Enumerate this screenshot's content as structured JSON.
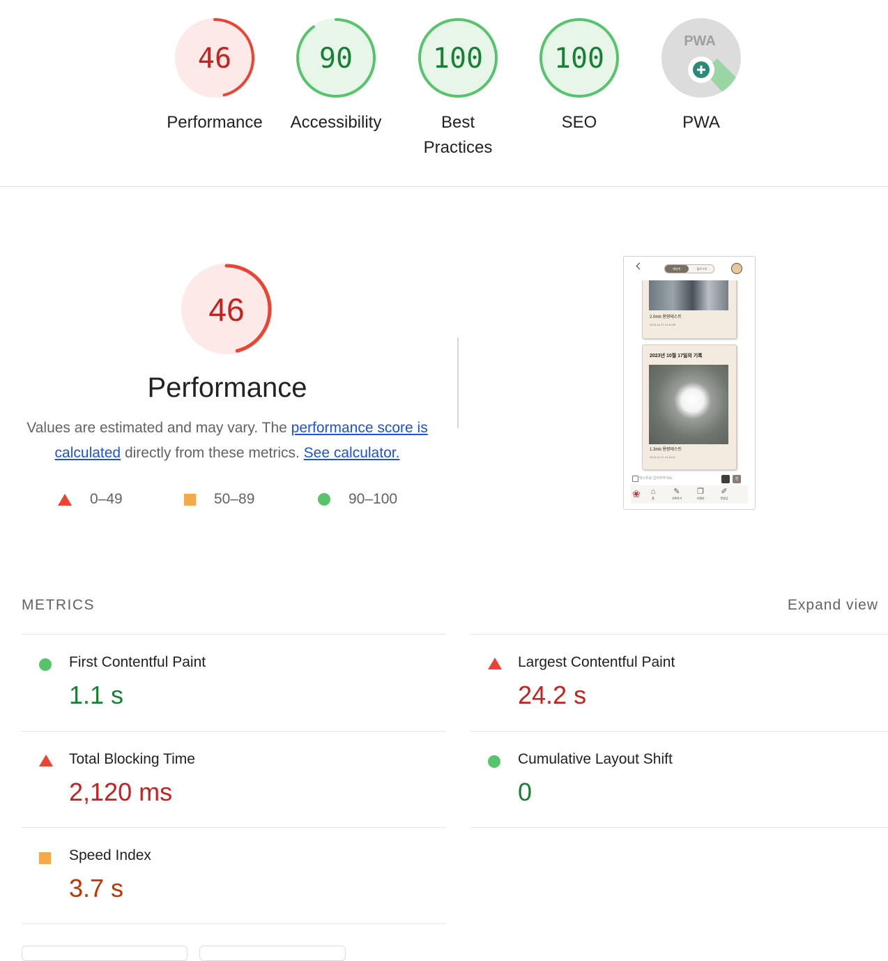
{
  "gauges": [
    {
      "id": "performance",
      "score": "46",
      "label": "Performance",
      "status": "fail",
      "fraction": 0.46
    },
    {
      "id": "accessibility",
      "score": "90",
      "label": "Accessibility",
      "status": "pass",
      "fraction": 0.9
    },
    {
      "id": "best-practices",
      "score": "100",
      "label": "Best Practices",
      "status": "pass",
      "fraction": 1.0
    },
    {
      "id": "seo",
      "score": "100",
      "label": "SEO",
      "status": "pass",
      "fraction": 1.0
    },
    {
      "id": "pwa",
      "score": "",
      "label": "PWA",
      "badge_text": "PWA",
      "status": "na",
      "icon": "pwa-plus-icon"
    }
  ],
  "performance": {
    "score": "46",
    "fraction": 0.46,
    "title": "Performance",
    "desc_prefix": "Values are estimated and may vary. The ",
    "link_score": "performance score is calculated",
    "desc_middle": " directly from these metrics. ",
    "link_calc": "See calculator.",
    "legend": [
      {
        "shape": "triangle",
        "label": "0–49",
        "color": "#eb4334"
      },
      {
        "shape": "square",
        "label": "50–89",
        "color": "#f5a94b"
      },
      {
        "shape": "circle",
        "label": "90–100",
        "color": "#56c46b"
      }
    ]
  },
  "screenshot": {
    "toggle_on": "메일쉬",
    "toggle_off": "블로그쉬",
    "cards": [
      {
        "caption": "2.0mb 용량테스트",
        "timestamp": "2023-10-17 14:14:59"
      },
      {
        "header": "2023년 10월 17일의 기록",
        "caption": "1.3mb 용량테스트",
        "timestamp": "2023-10-17 14:15:11"
      }
    ],
    "input_placeholder": "텍스트를 입력하주세요.",
    "send_label": "전",
    "nav": [
      "홈",
      "기록하기",
      "리캡하",
      "문방답"
    ]
  },
  "metrics": {
    "heading": "METRICS",
    "expand_label": "Expand view",
    "items": [
      {
        "name": "First Contentful Paint",
        "value": "1.1 s",
        "status": "pass"
      },
      {
        "name": "Largest Contentful Paint",
        "value": "24.2 s",
        "status": "fail"
      },
      {
        "name": "Total Blocking Time",
        "value": "2,120 ms",
        "status": "fail"
      },
      {
        "name": "Cumulative Layout Shift",
        "value": "0",
        "status": "pass"
      },
      {
        "name": "Speed Index",
        "value": "3.7 s",
        "status": "average"
      }
    ]
  },
  "colors": {
    "fail": "#eb4334",
    "fail_text": "#c5221f",
    "average": "#f5a94b",
    "average_text": "#c33300",
    "pass": "#56c46b",
    "pass_text": "#188035",
    "link": "#1a52e8"
  }
}
